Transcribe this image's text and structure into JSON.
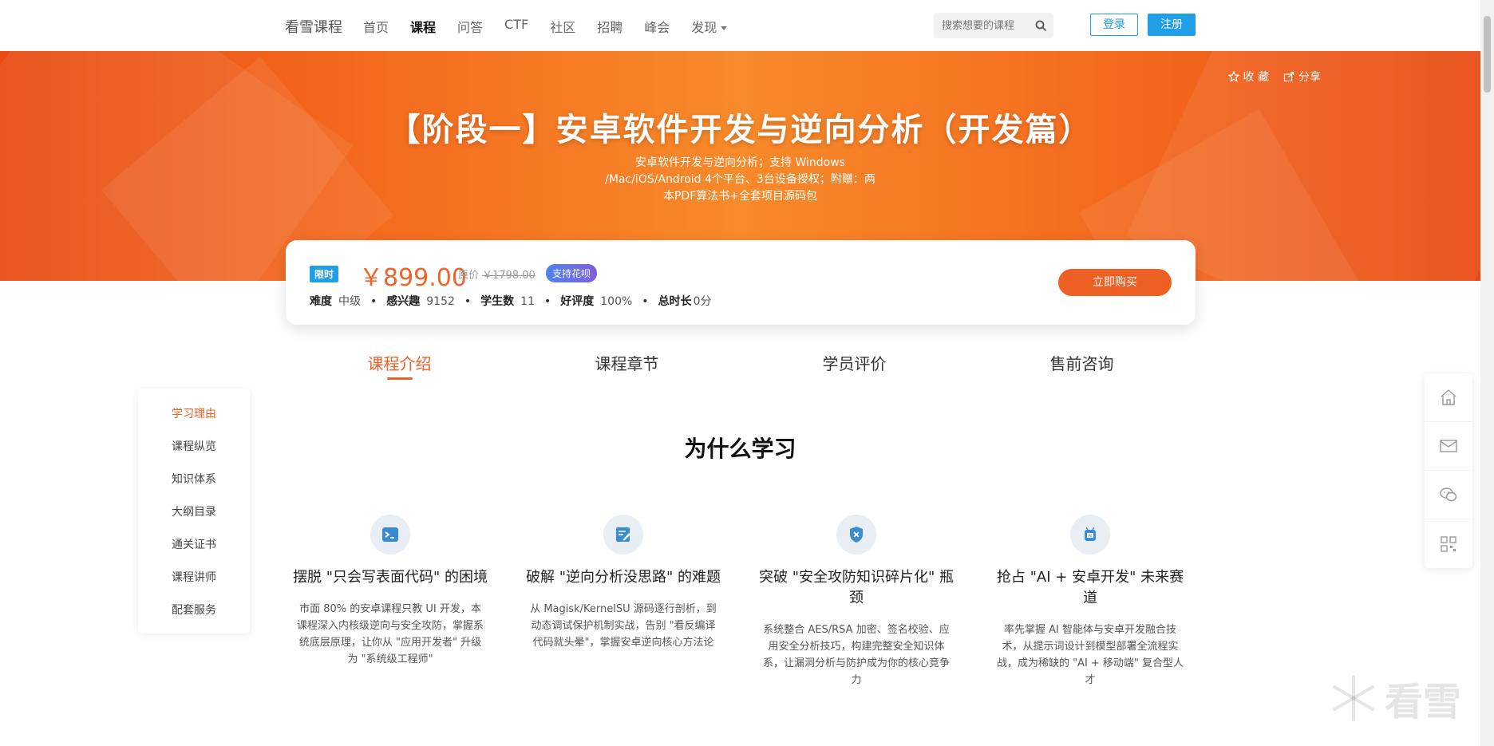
{
  "nav": {
    "brand": "看雪课程",
    "links": [
      "首页",
      "课程",
      "问答",
      "CTF",
      "社区",
      "招聘",
      "峰会",
      "发现"
    ],
    "search_placeholder": "搜索想要的课程",
    "login": "登录",
    "register": "注册"
  },
  "banner": {
    "collect": "收 藏",
    "share": "分享",
    "title": "【阶段一】安卓软件开发与逆向分析（开发篇）",
    "subtitle_lines": [
      "安卓软件开发与逆向分析；支持 Windows",
      "/Mac/iOS/Android 4个平台、3台设备授权；附赠：两",
      "本PDF算法书+全套项目源码包"
    ]
  },
  "price_card": {
    "limit_tag": "限时",
    "price": "￥899.00",
    "orig_label": "原价",
    "orig_price": "￥1798.00",
    "huabei": "支持花呗",
    "meta": {
      "difficulty_label": "难度",
      "difficulty": "中级",
      "interest_label": "感兴趣",
      "interest": "9152",
      "students_label": "学生数",
      "students": "11",
      "rating_label": "好评度",
      "rating": "100%",
      "duration_label": "总时长",
      "duration": "0分"
    },
    "buy": "立即购买"
  },
  "tabs": [
    "课程介绍",
    "课程章节",
    "学员评价",
    "售前咨询"
  ],
  "sidenav": [
    "学习理由",
    "课程纵览",
    "知识体系",
    "大纲目录",
    "通关证书",
    "课程讲师",
    "配套服务"
  ],
  "section_title": "为什么学习",
  "features": [
    {
      "icon": "terminal-icon",
      "title": "摆脱 \"只会写表面代码\" 的困境",
      "desc": "市面 80% 的安卓课程只教 UI 开发，本课程深入内核级逆向与安全攻防，掌握系统底层原理，让你从 \"应用开发者\" 升级为 \"系统级工程师\""
    },
    {
      "icon": "edit-note-icon",
      "title": "破解 \"逆向分析没思路\" 的难题",
      "desc": "从 Magisk/KernelSU 源码逐行剖析，到动态调试保护机制实战，告别 \"看反编译代码就头晕\"，掌握安卓逆向核心方法论"
    },
    {
      "icon": "shield-icon",
      "title": "突破 \"安全攻防知识碎片化\" 瓶颈",
      "desc": "系统整合 AES/RSA 加密、签名校验、应用安全分析技巧，构建完整安全知识体系，让漏洞分析与防护成为你的核心竞争力"
    },
    {
      "icon": "android-ai-icon",
      "title": "抢占 \"AI + 安卓开发\" 未来赛道",
      "desc": "率先掌握 AI 智能体与安卓开发融合技术，从提示词设计到模型部署全流程实战，成为稀缺的 \"AI + 移动端\" 复合型人才"
    }
  ],
  "right_tools": [
    "home-icon",
    "mail-icon",
    "wechat-icon",
    "qrcode-icon"
  ],
  "watermark": "看雪",
  "colors": {
    "accent": "#ee5f24",
    "blue": "#1e9fe8",
    "banner": "#f46a1e"
  }
}
